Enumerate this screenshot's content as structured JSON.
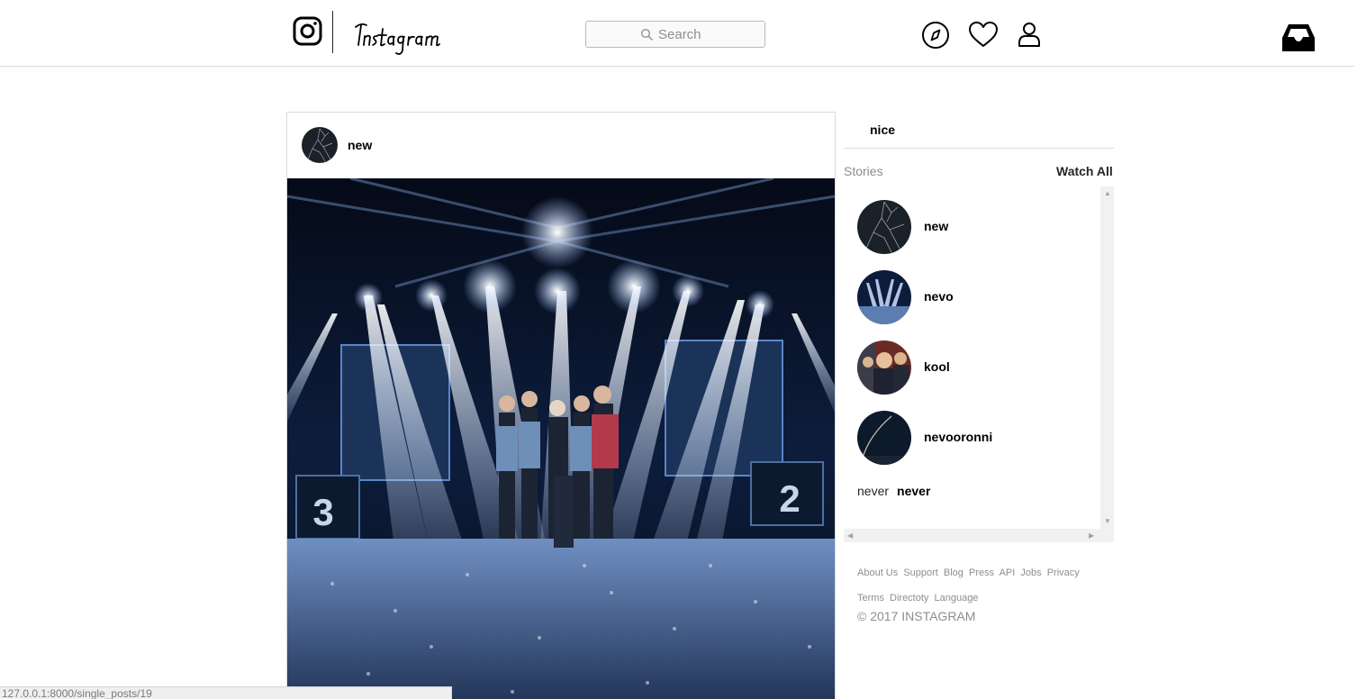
{
  "header": {
    "search_placeholder": "Search",
    "icons": [
      "instagram-glyph-icon",
      "compass-icon",
      "heart-icon",
      "user-icon",
      "inbox-icon"
    ]
  },
  "post": {
    "username": "new"
  },
  "sidebar": {
    "current_user": "nice",
    "stories_label": "Stories",
    "watch_all": "Watch All",
    "stories": [
      {
        "name": "new"
      },
      {
        "name": "nevo"
      },
      {
        "name": "kool"
      },
      {
        "name": "nevooronni"
      }
    ],
    "never_a": "never",
    "never_b": "never"
  },
  "footer": {
    "links": [
      "About Us",
      "Support",
      "Blog",
      "Press",
      "API",
      "Jobs",
      "Privacy",
      "Terms",
      "Directoty",
      "Language"
    ],
    "copyright": "© 2017 INSTAGRAM"
  },
  "status_url": "127.0.0.1:8000/single_posts/19",
  "colors": {
    "border": "#dbdbdb",
    "muted": "#8e8e8e",
    "text": "#262626"
  }
}
